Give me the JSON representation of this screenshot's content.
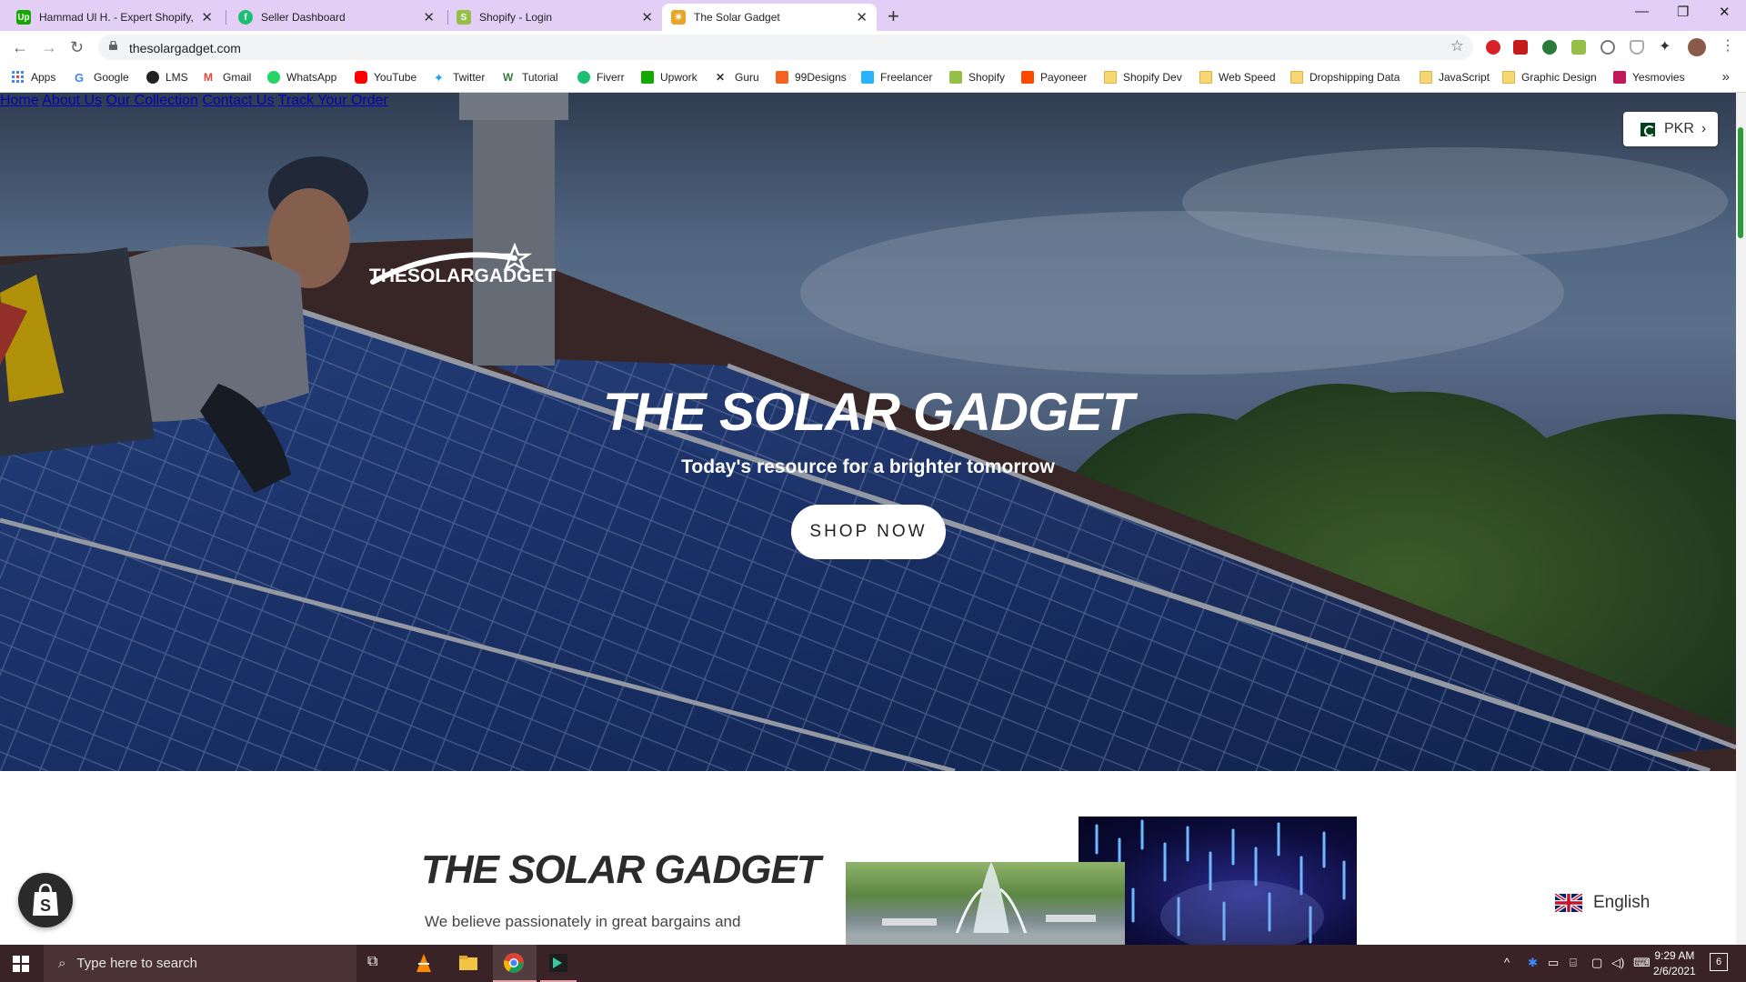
{
  "browser": {
    "tabs": [
      {
        "title": "Hammad Ul H. - Expert Shopify, W",
        "icon": "upwork-icon",
        "active": false
      },
      {
        "title": "Seller Dashboard",
        "icon": "fiverr-icon",
        "active": false
      },
      {
        "title": "Shopify - Login",
        "icon": "shopify-icon",
        "active": false
      },
      {
        "title": "The Solar Gadget",
        "icon": "solar-gadget-icon",
        "active": true
      }
    ],
    "new_tab": "+",
    "url": "thesolargadget.com",
    "bookmarks": [
      {
        "label": "Apps",
        "icon": "apps-grid-icon"
      },
      {
        "label": "Google",
        "icon": "google-icon"
      },
      {
        "label": "LMS",
        "icon": "lms-icon"
      },
      {
        "label": "Gmail",
        "icon": "gmail-icon"
      },
      {
        "label": "WhatsApp",
        "icon": "whatsapp-icon"
      },
      {
        "label": "YouTube",
        "icon": "youtube-icon"
      },
      {
        "label": "Twitter",
        "icon": "twitter-icon"
      },
      {
        "label": "Tutorial",
        "icon": "tutorial-icon"
      },
      {
        "label": "Fiverr",
        "icon": "fiverr-icon"
      },
      {
        "label": "Upwork",
        "icon": "upwork-icon"
      },
      {
        "label": "Guru",
        "icon": "guru-icon"
      },
      {
        "label": "99Designs",
        "icon": "99designs-icon"
      },
      {
        "label": "Freelancer",
        "icon": "freelancer-icon"
      },
      {
        "label": "Shopify",
        "icon": "shopify-icon"
      },
      {
        "label": "Payoneer",
        "icon": "payoneer-icon"
      },
      {
        "label": "Shopify Dev",
        "icon": "folder-icon"
      },
      {
        "label": "Web Speed",
        "icon": "folder-icon"
      },
      {
        "label": "Dropshipping Data",
        "icon": "folder-icon"
      },
      {
        "label": "JavaScript",
        "icon": "folder-icon"
      },
      {
        "label": "Graphic Design",
        "icon": "folder-icon"
      },
      {
        "label": "Yesmovies",
        "icon": "yesmovies-icon"
      }
    ],
    "bookmarks_more": "»"
  },
  "site": {
    "logo_text": "THESOLARGADGET",
    "nav": [
      "Home",
      "About Us",
      "Our Collection",
      "Contact Us",
      "Track Your Order"
    ],
    "currency": "PKR",
    "hero": {
      "title": "THE SOLAR GADGET",
      "subtitle": "Today's resource for a brighter tomorrow",
      "cta": "SHOP NOW"
    },
    "intro": {
      "title": "THE SOLAR GADGET",
      "text": "We believe passionately in great bargains and"
    },
    "language": "English"
  },
  "taskbar": {
    "search_placeholder": "Type here to search",
    "time": "9:29 AM",
    "date": "2/6/2021",
    "notification_count": "6"
  },
  "colors": {
    "tabstrip": "#e3cff5",
    "taskbar": "#3a2326",
    "scroll_thumb": "#2e9b3a"
  }
}
